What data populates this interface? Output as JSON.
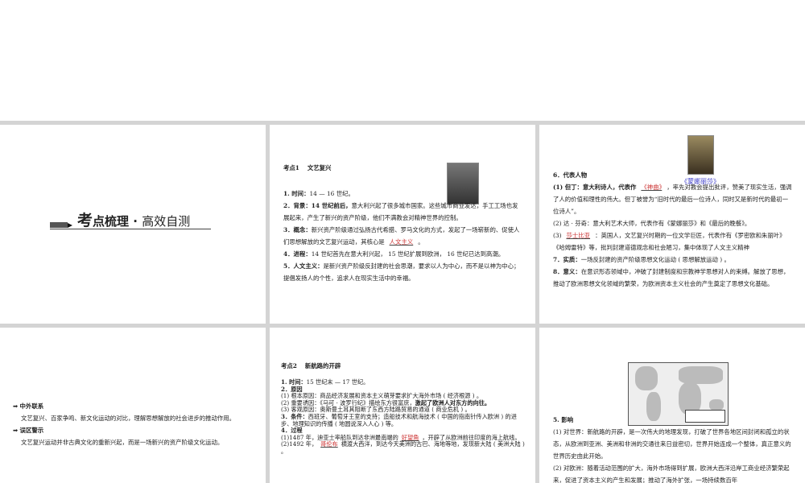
{
  "slide1": {
    "title_big": "考",
    "title_rest": "点梳理",
    "title_sep": " · ",
    "title_sub": "高效自测"
  },
  "slide2": {
    "heading": "考点1　 文艺复兴",
    "l1_label": "1. 时间：",
    "l1": "14 — 16 世纪。",
    "l2_label": "2．背景：",
    "l2_bold": "14 世纪前后，",
    "l2": "意大利兴起了很多城市国家。这些城市商业发达，手工工场也发展起来，产生了新兴的资产阶级，他们不满教会对精神世界的控制。",
    "l3_label": "3．概念：",
    "l3": "新兴资产阶级通过弘扬古代希腊、罗马文化的方式，发起了一场崭新的、促使人们思想解放的文艺复兴运动，其核心是",
    "l3_ans": "人文主义",
    "l3_end": "。",
    "l4_label": "4．进程：",
    "l4": "14 世纪首先在意大利兴起， 15 世纪扩展到欧洲， 16 世纪已达到高潮。",
    "l5_label": "5．人文主义：",
    "l5": "是新兴资产阶级反封建的社会思潮，要求以人为中心，而不是以神为中心；提倡发扬人的个性，追求人在现实生活中的幸福。"
  },
  "slide3": {
    "image_caption": "《蒙娜丽莎》",
    "l6": "6．代表人物",
    "p1_bold": "(1) 但丁：意大利诗人，代表作",
    "p1_ans": "《神曲》",
    "p1": "，率先对教会提出批评，赞美了现实生活，强调了人的价值和理性的伟大。但丁被誉为“旧时代的最后一位诗人，同时又是新时代的最初一位诗人”。",
    "p2": "(2) 达 · 芬奇：意大利艺术大师，代表作有《蒙娜丽莎》和《最后的晚餐》。",
    "p3_pre": "(3)",
    "p3_ans": "莎士比亚",
    "p3": "：英国人，文艺复兴时期的一位文学巨匠，代表作有《罗密欧和朱丽叶》《哈姆雷特》等，批判封建道德观念和社会陋习，集中体现了人文主义精神",
    "l7_label": "7．实质：",
    "l7": "一场反封建的资产阶级思想文化运动 ( 思想解放运动 ) 。",
    "l8_label": "8．意义：",
    "l8": "在意识形态领域中，冲破了封建制度和宗教神学思想对人的束缚。解放了思想，推动了欧洲思想文化领域的繁荣，为欧洲资本主义社会的产生奠定了思想文化基础。"
  },
  "slide4": {
    "h1": "中外联系",
    "t1": "文艺复兴、百家争鸣、新文化运动的对比，理解思想解放的社会进步的推动作用。",
    "h2": "误区警示",
    "t2": "文艺复兴运动并非古典文化的重新兴起，而是一场新兴的资产阶级文化运动。"
  },
  "slide5": {
    "heading": "考点2　 新航路的开辟",
    "l1_label": "1. 时间：",
    "l1": "15 世纪末 — 17 世纪。",
    "l2": "2．原因",
    "r1": "(1) 根本原因：商品经济发展和资本主义萌芽要求扩大海外市场 ( 经济根源 ) 。",
    "r2": "(2) 重要诱因：《马可 · 波罗行纪》描绘东方很富庶，",
    "r2_bold": "激起了欧洲人对东方的向往。",
    "r3": "(3) 客观原因：奥斯曼土耳其阻断了东西方陆路贸易的通道 ( 商业危机 ) 。",
    "l3_label": "3．条件：",
    "l3": "西班牙、葡萄牙王室的支持；造船技术和航海技术 ( 中国的指南针传入欧洲 ) 的进步、地理知识的传播 ( 地圆说深入人心 ) 等。",
    "l4": "4．过程",
    "g1_pre": "(1)1487 年，迪亚士率船队到达非洲最南端的",
    "g1_ans": "好望角",
    "g1": "，开辟了从欧洲前往印度的海上航线。",
    "g2_pre": "(2)1492 年，",
    "g2_ans": "哥伦布",
    "g2": "横渡大西洋，到达今天美洲的古巴、海地等地，发现新大陆 ( 美洲大陆 ) 。"
  },
  "slide6": {
    "l5": "5. 影响",
    "p1": "(1) 对世界：新航路的开辟，是一次伟大的地理发现，打破了世界各地区间封闭和孤立的状态，从欧洲到亚洲、美洲和非洲的交通往来日益密切，世界开始连成一个整体，真正意义的世界历史由此开始。",
    "p2": "(2) 对欧洲：随着活动范围的扩大，海外市场得到扩展，欧洲大西洋沿岸工商业经济繁荣起来，促进了资本主义的产生和发展；推动了海外扩张，一场持续数百年"
  }
}
